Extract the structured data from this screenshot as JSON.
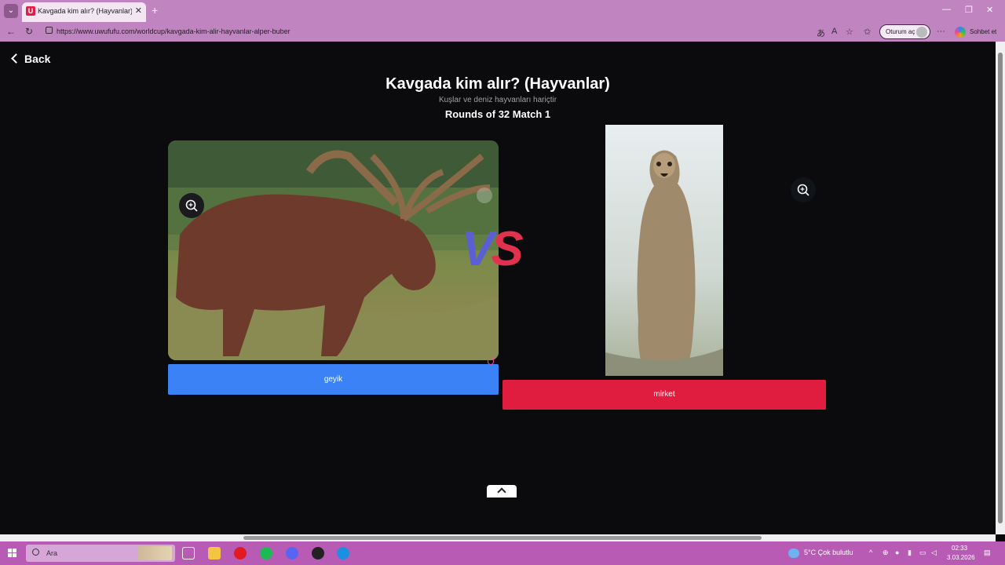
{
  "browser": {
    "tab_title": "Kavgada kim alır? (Hayvanlar) | Uw",
    "tab_favicon_letter": "U",
    "new_tab": "+",
    "url": "https://www.uwufufu.com/worldcup/kavgada-kim-alir-hayvanlar-alper-buber",
    "signin_label": "Oturum aç",
    "copilot_label": "Sohbet et"
  },
  "page": {
    "back_label": "Back",
    "title": "Kavgada kim alır? (Hayvanlar)",
    "subtitle": "Kuşlar ve deniz hayvanları hariçtir",
    "round_info": "Rounds of 32 Match 1",
    "vs_v": "V",
    "vs_s": "S",
    "left_choice": {
      "label": "geyik",
      "icon": "moose-image"
    },
    "right_choice": {
      "label": "mirket",
      "icon": "meerkat-image"
    },
    "colors": {
      "left": "#3b82f6",
      "right": "#e11d3f",
      "bg": "#0b0b0d"
    }
  },
  "taskbar": {
    "search_label": "Ara",
    "weather": "5°C  Çok bulutlu",
    "time": "02:33",
    "date": "3.03.2026"
  }
}
